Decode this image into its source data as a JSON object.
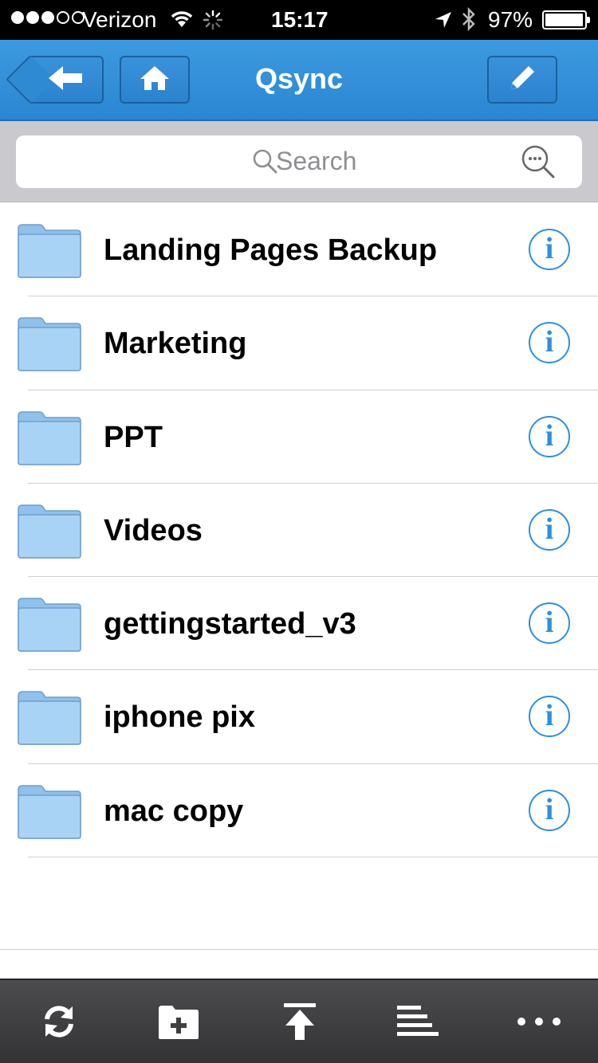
{
  "status_bar": {
    "carrier": "Verizon",
    "time": "15:17",
    "battery_percent": "97%",
    "battery_level": 0.97,
    "signal_bars": 3,
    "icons": [
      "signal-dots-icon",
      "wifi-icon",
      "activity-spinner-icon",
      "location-arrow-icon",
      "bluetooth-icon",
      "battery-icon"
    ]
  },
  "nav": {
    "title": "Qsync",
    "buttons": [
      "back-arrow-icon",
      "home-icon",
      "pencil-icon"
    ]
  },
  "search": {
    "placeholder": "Search",
    "icons": [
      "search-icon",
      "advanced-search-icon"
    ]
  },
  "folders": [
    {
      "name": "Landing Pages Backup"
    },
    {
      "name": "Marketing"
    },
    {
      "name": "PPT"
    },
    {
      "name": "Videos"
    },
    {
      "name": "gettingstarted_v3"
    },
    {
      "name": "iphone pix"
    },
    {
      "name": "mac copy"
    }
  ],
  "info_glyph": "i",
  "toolbar": {
    "icons": [
      "refresh-icon",
      "new-folder-icon",
      "upload-icon",
      "sort-icon",
      "more-icon"
    ]
  },
  "colors": {
    "nav_blue": "#2f8ad4",
    "info_blue": "#2b8fe5",
    "folder_blue": "#a9d3f5",
    "toolbar_dark": "#3f3f42"
  }
}
